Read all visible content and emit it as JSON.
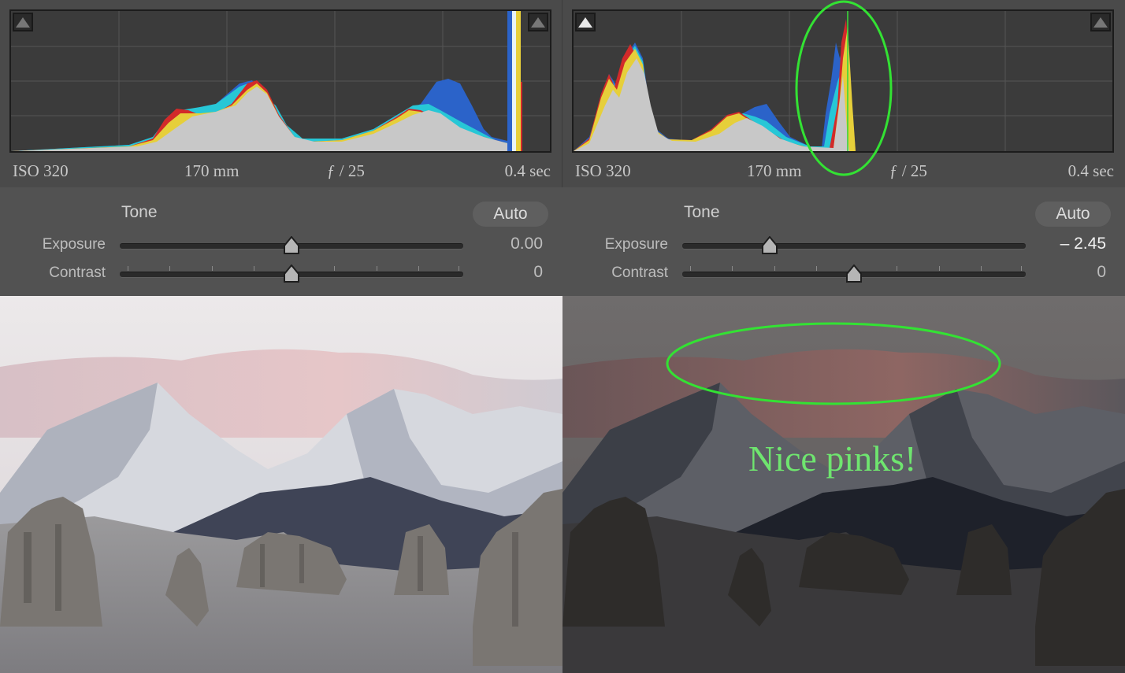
{
  "panels": [
    {
      "side": "left",
      "histogram": {
        "shadow_clip_warning": false,
        "highlight_clip_warning": false
      },
      "meta": {
        "iso": "ISO 320",
        "focal": "170 mm",
        "aperture": "ƒ / 25",
        "shutter": "0.4 sec"
      },
      "tone": {
        "title": "Tone",
        "auto_label": "Auto",
        "exposure": {
          "label": "Exposure",
          "value_text": "0.00",
          "value": 0.0,
          "range": [
            -5,
            5
          ]
        },
        "contrast": {
          "label": "Contrast",
          "value_text": "0",
          "value": 0,
          "range": [
            -100,
            100
          ]
        }
      }
    },
    {
      "side": "right",
      "histogram": {
        "shadow_clip_warning": true,
        "highlight_clip_warning": false
      },
      "meta": {
        "iso": "ISO 320",
        "focal": "170 mm",
        "aperture": "ƒ / 25",
        "shutter": "0.4 sec"
      },
      "tone": {
        "title": "Tone",
        "auto_label": "Auto",
        "exposure": {
          "label": "Exposure",
          "value_text": "– 2.45",
          "value": -2.45,
          "range": [
            -5,
            5
          ]
        },
        "contrast": {
          "label": "Contrast",
          "value_text": "0",
          "value": 0,
          "range": [
            -100,
            100
          ]
        }
      }
    }
  ],
  "annotation": {
    "text": "Nice pinks!",
    "color": "#6fe56f"
  },
  "colors": {
    "panel_bg": "#4a4a4a",
    "hist_bg": "#3b3b3b",
    "annotation_green": "#33e233"
  }
}
